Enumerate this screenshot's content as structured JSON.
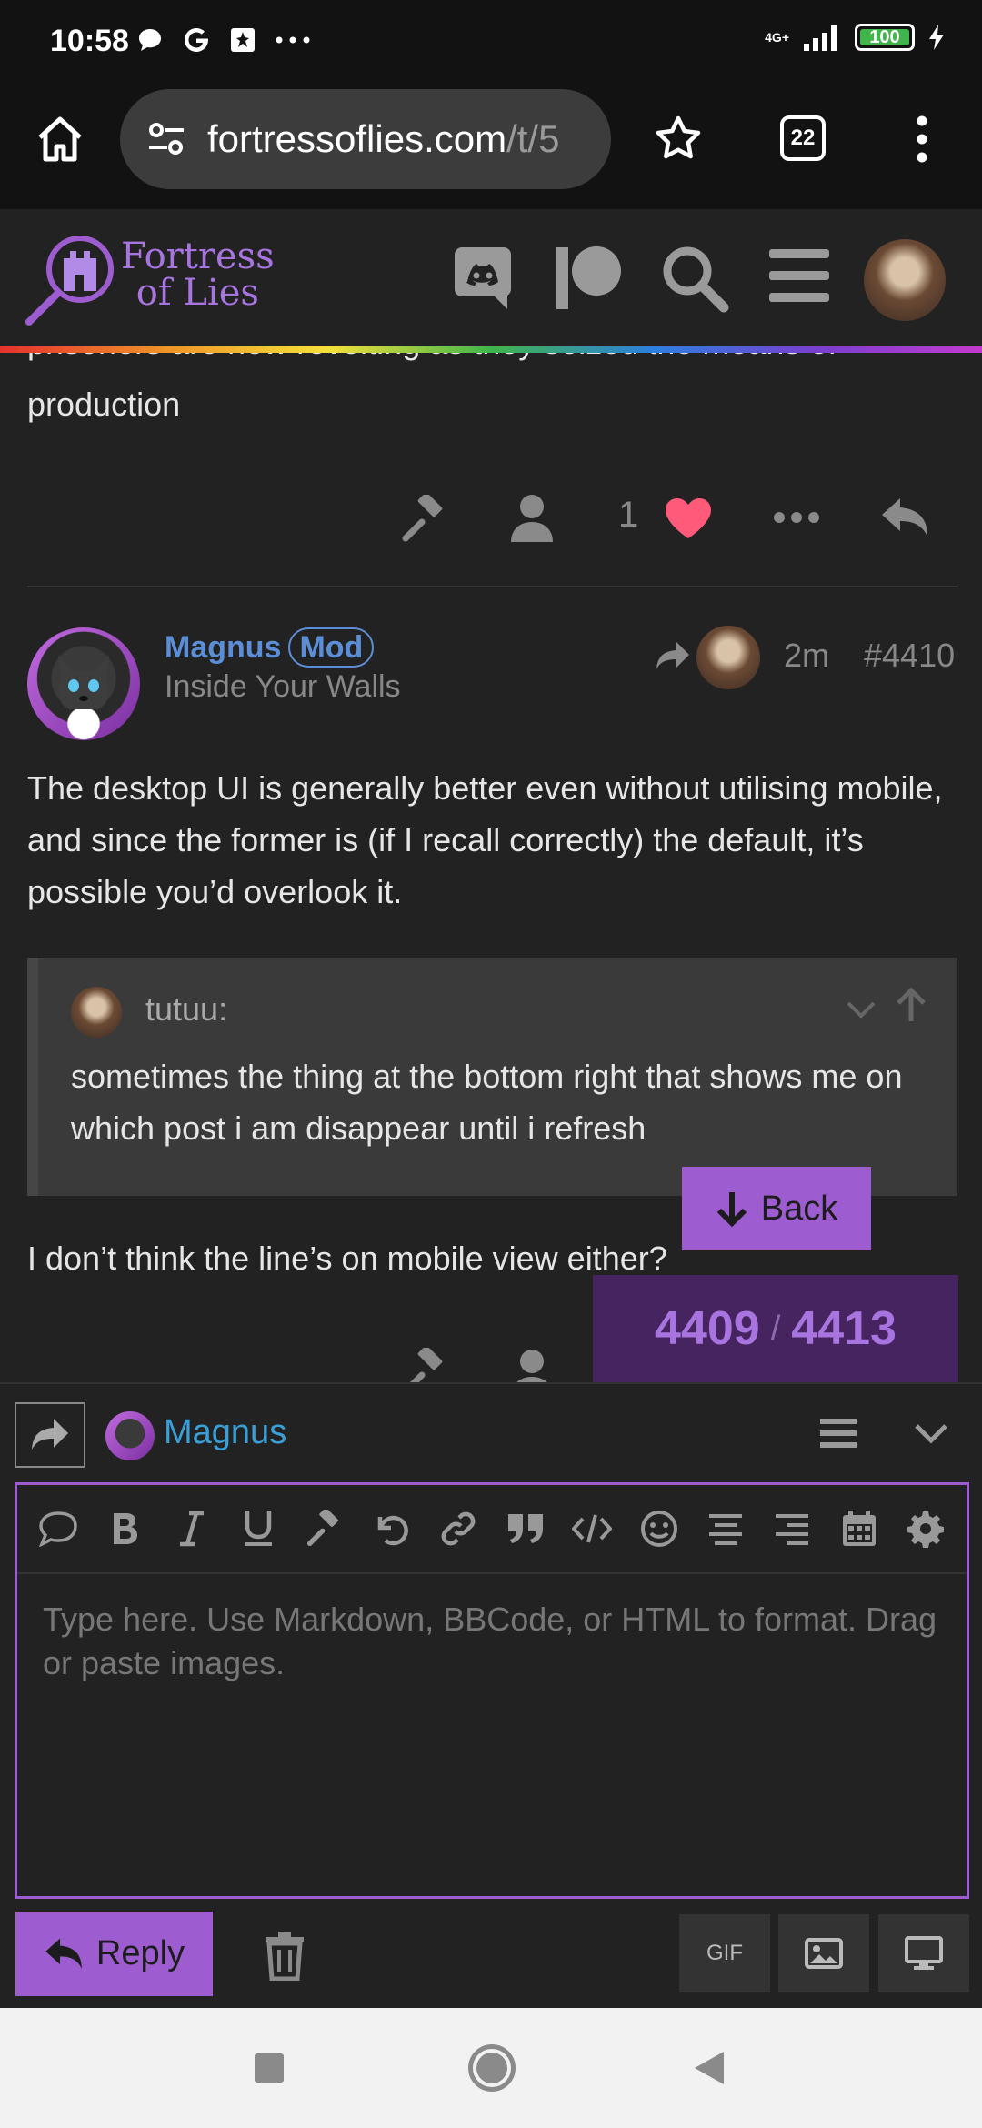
{
  "status_bar": {
    "time": "10:58",
    "network": "4G+",
    "battery": "100"
  },
  "browser": {
    "url_host": "fortressoflies.com",
    "url_path": "/t/5",
    "tab_count": "22"
  },
  "site": {
    "logo_line1": "Fortress",
    "logo_line2": "of Lies",
    "accent": "#9d5dd0"
  },
  "post_prev": {
    "text_cut": "prisoners are now revolting as they seized the means of",
    "text_line2": "production",
    "like_count": "1"
  },
  "post": {
    "username": "Magnus",
    "badge": "Mod",
    "title": "Inside Your Walls",
    "time": "2m",
    "number": "#4410",
    "body": "The desktop UI is generally better even without utilising mobile, and since the former is (if I recall correctly) the default, it’s possible you’d overlook it.",
    "quote": {
      "author": "tutuu:",
      "text": "sometimes the thing at the bottom right that shows me on which post i am disappear until i refresh"
    },
    "after_quote": "I don’t think the line’s on mobile view either?"
  },
  "navigation": {
    "back_label": "Back",
    "current": "4409",
    "separator": "/",
    "total": "4413"
  },
  "composer": {
    "reply_to": "Magnus",
    "placeholder": "Type here. Use Markdown, BBCode, or HTML to format. Drag or paste images.",
    "reply_label": "Reply",
    "gif_label": "GIF"
  }
}
